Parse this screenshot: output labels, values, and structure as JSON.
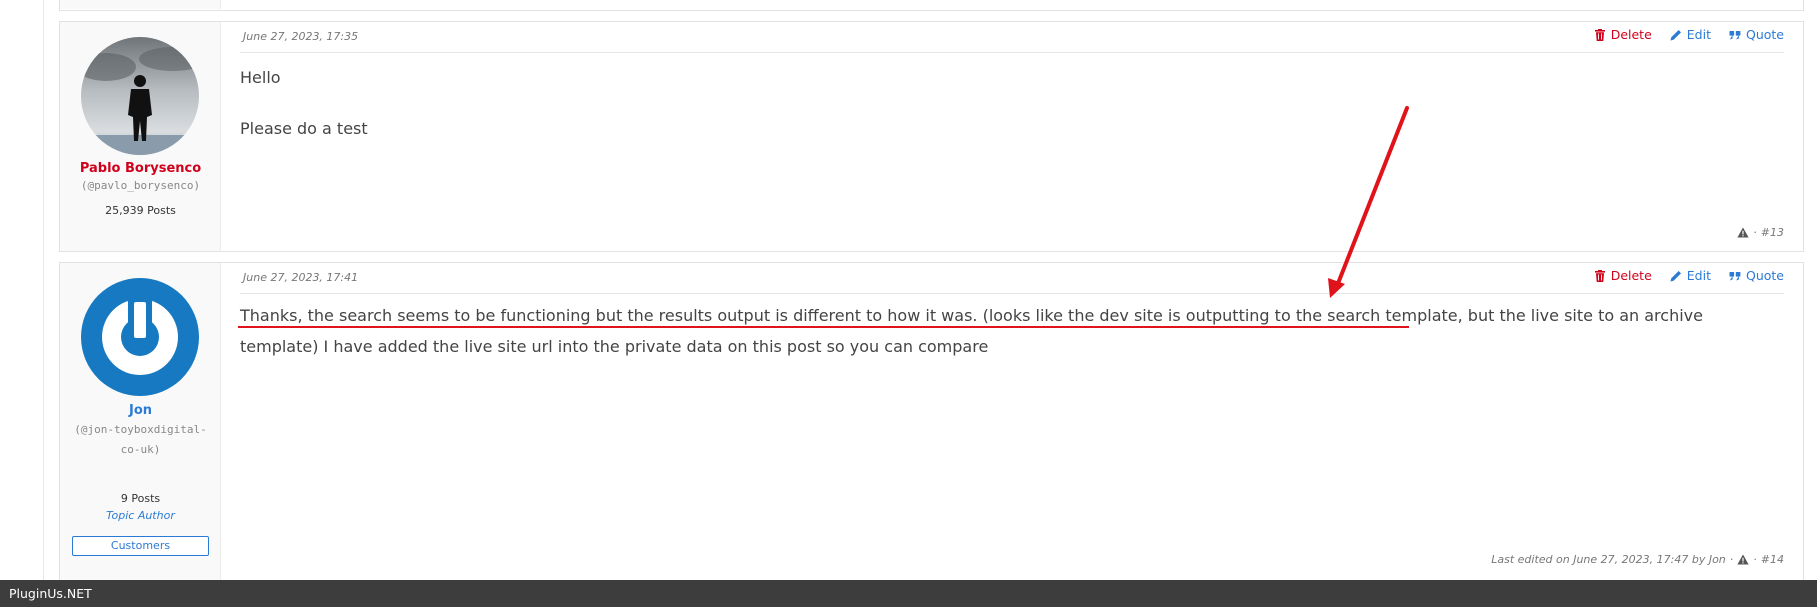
{
  "posts": [
    {
      "author": {
        "name": "Pablo Borysenco",
        "handle": "(@pavlo_borysenco)",
        "posts": "25,939 Posts",
        "name_color": "#d0021b"
      },
      "date": "June 27, 2023, 17:35",
      "actions": {
        "delete": "Delete",
        "edit": "Edit",
        "quote": "Quote"
      },
      "body": [
        "Hello",
        "Please  do a test"
      ],
      "footer": {
        "separator": "·",
        "number": "#13"
      }
    },
    {
      "author": {
        "name": "Jon",
        "handle": "(@jon-toyboxdigital-co-uk)",
        "posts": "9 Posts",
        "topic_author": "Topic Author",
        "role": "Customers",
        "name_color": "#2b7bd6"
      },
      "date": "June 27, 2023, 17:41",
      "actions": {
        "delete": "Delete",
        "edit": "Edit",
        "quote": "Quote"
      },
      "body": [
        "Thanks, the search seems to be functioning but the results output is different to how it was. (looks like the dev site is outputting to the search template, but the live site to an archive template) I have added the live site url into the private data on this post so you can compare"
      ],
      "footer": {
        "edited": "Last edited on June 27, 2023, 17:47 by Jon",
        "separator": "·",
        "number": "#14"
      }
    }
  ],
  "footer_bar": {
    "brand": "PluginUs.NET"
  },
  "colors": {
    "delete": "#d0021b",
    "link": "#2b7bd6",
    "annotation": "#e0131a",
    "bar": "#3d3d3d"
  }
}
